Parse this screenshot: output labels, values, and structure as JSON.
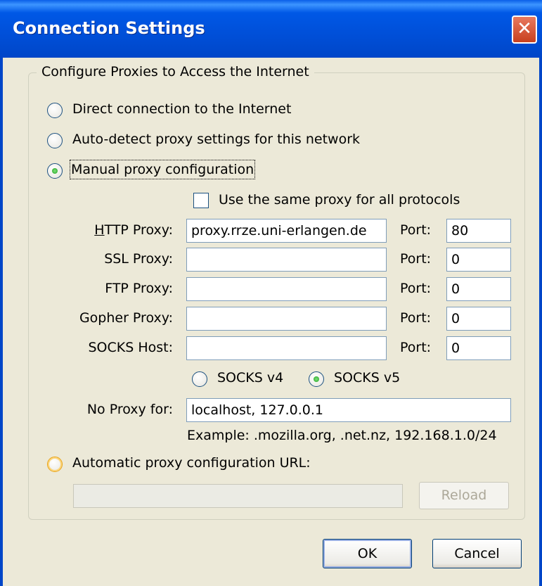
{
  "window": {
    "title": "Connection Settings",
    "close_glyph": "✕"
  },
  "group": {
    "legend": "Configure Proxies to Access the Internet"
  },
  "options": {
    "direct": {
      "label": "Direct connection to the Internet",
      "checked": false
    },
    "autodetect": {
      "label": "Auto-detect proxy settings for this network",
      "checked": false
    },
    "manual": {
      "label": "Manual proxy configuration",
      "checked": true
    },
    "auto_url": {
      "label": "Automatic proxy configuration URL:",
      "checked": false
    }
  },
  "same_proxy": {
    "label": "Use the same proxy for all protocols",
    "checked": false
  },
  "proxies": {
    "http": {
      "label": "HTTP Proxy:",
      "value": "proxy.rrze.uni-erlangen.de",
      "port_label": "Port:",
      "port": "80"
    },
    "ssl": {
      "label": "SSL Proxy:",
      "value": "",
      "port_label": "Port:",
      "port": "0"
    },
    "ftp": {
      "label": "FTP Proxy:",
      "value": "",
      "port_label": "Port:",
      "port": "0"
    },
    "gopher": {
      "label": "Gopher Proxy:",
      "value": "",
      "port_label": "Port:",
      "port": "0"
    },
    "socks": {
      "label": "SOCKS Host:",
      "value": "",
      "port_label": "Port:",
      "port": "0"
    }
  },
  "socks_version": {
    "v4": "SOCKS v4",
    "v5": "SOCKS v5",
    "selected": "v5"
  },
  "no_proxy": {
    "label": "No Proxy for:",
    "value": "localhost, 127.0.0.1",
    "example": "Example: .mozilla.org, .net.nz, 192.168.1.0/24"
  },
  "auto_url_field": {
    "value": ""
  },
  "buttons": {
    "reload": "Reload",
    "ok": "OK",
    "cancel": "Cancel"
  },
  "colors": {
    "titlebar": "#0054e3",
    "dialog_bg": "#ece9d8",
    "close": "#d84a25",
    "radio_check": "#21a121"
  }
}
